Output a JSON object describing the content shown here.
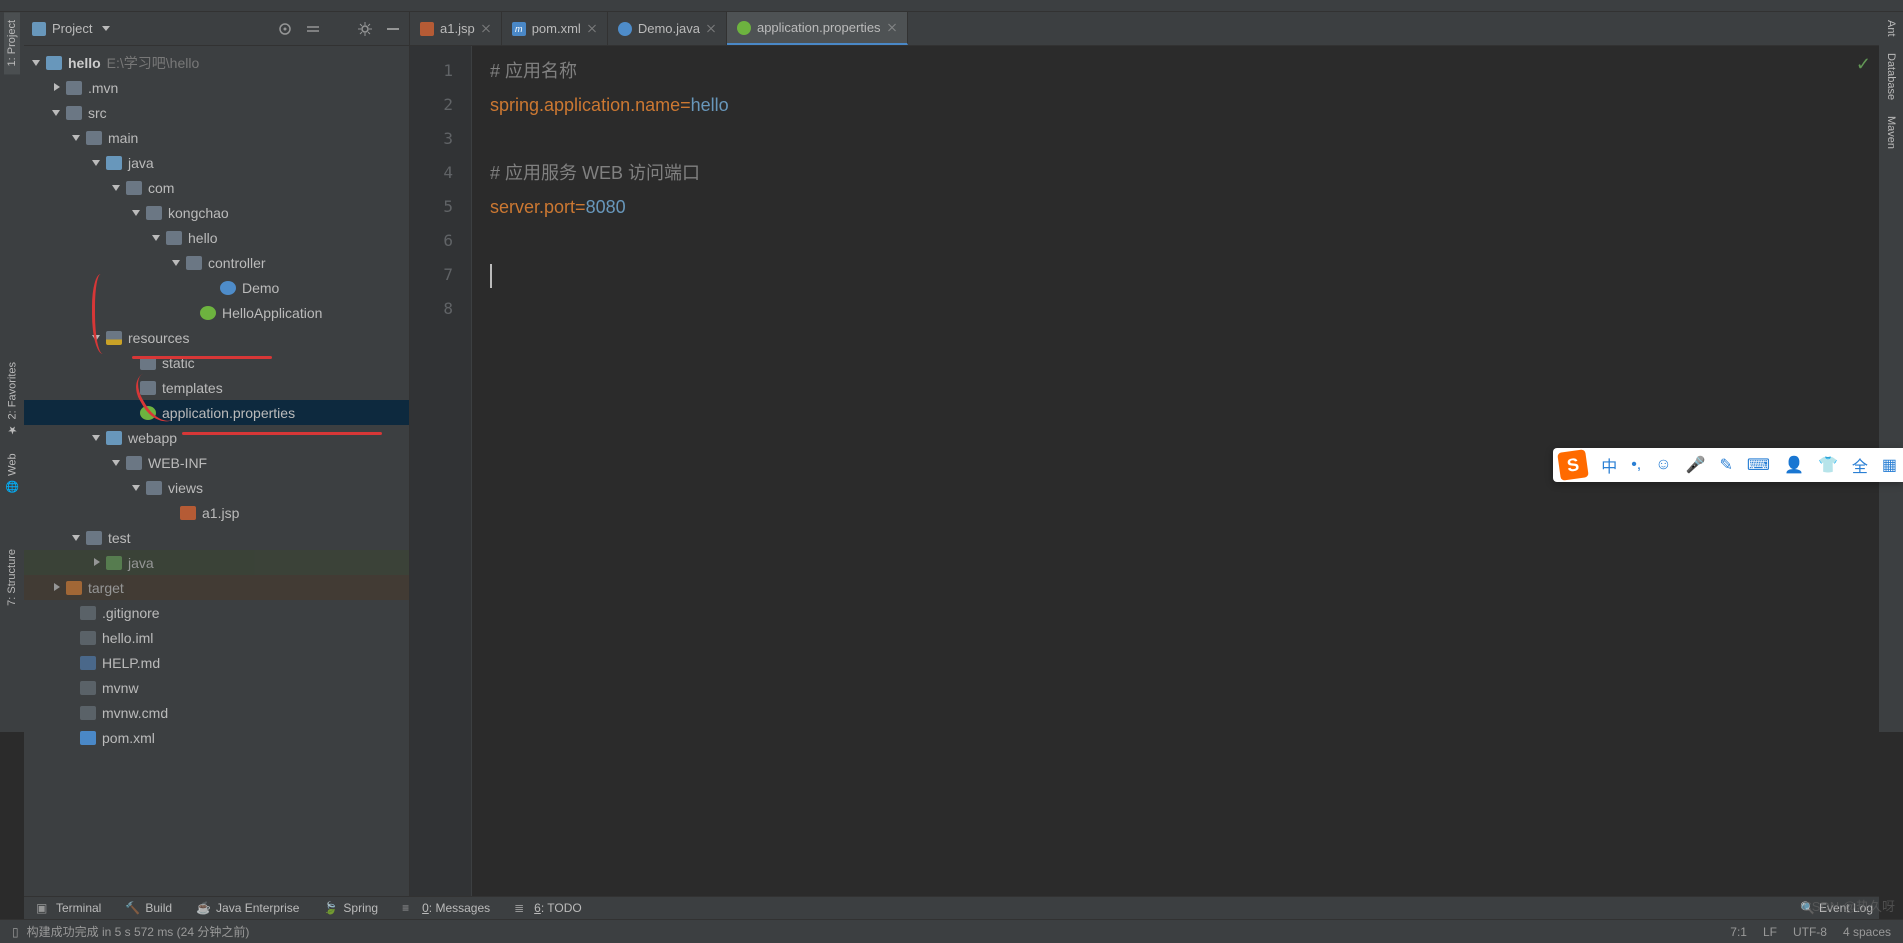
{
  "project_panel": {
    "title": "Project",
    "root": {
      "name": "hello",
      "path": "E:\\学习吧\\hello"
    }
  },
  "tree": {
    "mvn": ".mvn",
    "src": "src",
    "main": "main",
    "java": "java",
    "com": "com",
    "kongchao": "kongchao",
    "hello_pkg": "hello",
    "controller": "controller",
    "demo": "Demo",
    "hello_app": "HelloApplication",
    "resources": "resources",
    "static": "static",
    "templates": "templates",
    "app_props": "application.properties",
    "webapp": "webapp",
    "webinf": "WEB-INF",
    "views": "views",
    "a1jsp": "a1.jsp",
    "test": "test",
    "java2": "java",
    "target": "target",
    "gitignore": ".gitignore",
    "helloiml": "hello.iml",
    "helpmd": "HELP.md",
    "mvnw": "mvnw",
    "mvnwcmd": "mvnw.cmd",
    "pomxml": "pom.xml"
  },
  "tabs": [
    {
      "label": "a1.jsp",
      "icon": "#b55b35"
    },
    {
      "label": "pom.xml",
      "icon": "#4a88c7"
    },
    {
      "label": "Demo.java",
      "icon": "#4e8cc9"
    },
    {
      "label": "application.properties",
      "icon": "#6db33f",
      "active": true
    }
  ],
  "code": {
    "l1": "# 应用名称",
    "l2a": "spring.application.name",
    "l2b": "=",
    "l2c": "hello",
    "l4": "# 应用服务 WEB 访问端口",
    "l5a": "server.port",
    "l5b": "=",
    "l5c": "8080"
  },
  "left_tools": {
    "project": "1: Project",
    "favorites": "2: Favorites",
    "web": "Web",
    "structure": "7: Structure"
  },
  "right_tools": {
    "ant": "Ant",
    "database": "Database",
    "maven": "Maven"
  },
  "bottom": {
    "terminal": "Terminal",
    "build": "Build",
    "java_ee": "Java Enterprise",
    "spring": "Spring",
    "messages": "0: Messages",
    "todo": "6: TODO",
    "event_log": "Event Log"
  },
  "status": {
    "build_msg": "构建成功完成 in 5 s 572 ms (24 分钟之前)",
    "pos": "7:1",
    "line_sep": "LF",
    "encoding": "UTF-8",
    "indent": "4 spaces"
  },
  "sogou": {
    "zh": "中",
    "full": "全"
  },
  "watermark": "CSDN @热久呀"
}
